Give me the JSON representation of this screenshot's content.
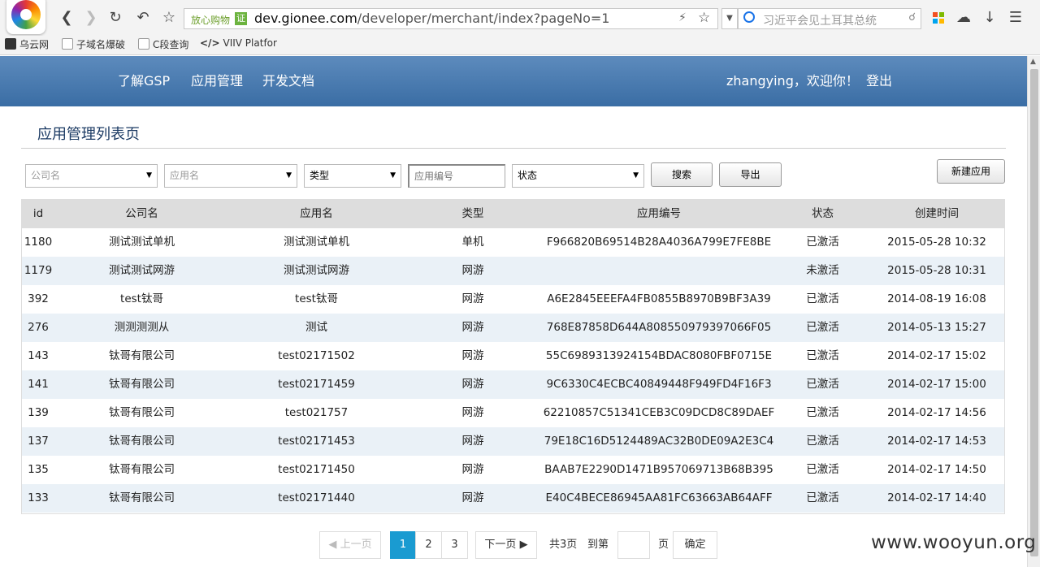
{
  "browser": {
    "secure_label": "放心购物",
    "cert_badge": "证",
    "url_host": "dev.gionee.com",
    "url_path": "/developer/merchant/index?pageNo=1",
    "search_placeholder": "习近平会见土耳其总统",
    "bookmarks": [
      "乌云网",
      "子域名爆破",
      "C段查询",
      "VIIV Platfor"
    ]
  },
  "header": {
    "nav": [
      "了解GSP",
      "应用管理",
      "开发文档"
    ],
    "welcome": "zhangying，欢迎你！",
    "logout": "登出"
  },
  "page_title": "应用管理列表页",
  "filters": {
    "company_placeholder": "公司名",
    "app_placeholder": "应用名",
    "type_value": "类型",
    "appno_placeholder": "应用编号",
    "status_value": "状态",
    "search_btn": "搜索",
    "export_btn": "导出",
    "new_btn": "新建应用"
  },
  "table": {
    "headers": [
      "id",
      "公司名",
      "应用名",
      "类型",
      "应用编号",
      "状态",
      "创建时间"
    ],
    "rows": [
      [
        "1180",
        "测试测试单机",
        "测试测试单机",
        "单机",
        "F966820B69514B28A4036A799E7FE8BE",
        "已激活",
        "2015-05-28 10:32"
      ],
      [
        "1179",
        "测试测试网游",
        "测试测试网游",
        "网游",
        "",
        "未激活",
        "2015-05-28 10:31"
      ],
      [
        "392",
        "test钛哥",
        "test钛哥",
        "网游",
        "A6E2845EEEFA4FB0855B8970B9BF3A39",
        "已激活",
        "2014-08-19 16:08"
      ],
      [
        "276",
        "测测测测从",
        "测试",
        "网游",
        "768E87858D644A808550979397066F05",
        "已激活",
        "2014-05-13 15:27"
      ],
      [
        "143",
        "钛哥有限公司",
        "test02171502",
        "网游",
        "55C6989313924154BDAC8080FBF0715E",
        "已激活",
        "2014-02-17 15:02"
      ],
      [
        "141",
        "钛哥有限公司",
        "test02171459",
        "网游",
        "9C6330C4ECBC40849448F949FD4F16F3",
        "已激活",
        "2014-02-17 15:00"
      ],
      [
        "139",
        "钛哥有限公司",
        "test021757",
        "网游",
        "62210857C51341CEB3C09DCD8C89DAEF",
        "已激活",
        "2014-02-17 14:56"
      ],
      [
        "137",
        "钛哥有限公司",
        "test02171453",
        "网游",
        "79E18C16D5124489AC32B0DE09A2E3C4",
        "已激活",
        "2014-02-17 14:53"
      ],
      [
        "135",
        "钛哥有限公司",
        "test02171450",
        "网游",
        "BAAB7E2290D1471B957069713B68B395",
        "已激活",
        "2014-02-17 14:50"
      ],
      [
        "133",
        "钛哥有限公司",
        "test02171440",
        "网游",
        "E40C4BECE86945AA81FC63663AB64AFF",
        "已激活",
        "2014-02-17 14:40"
      ]
    ]
  },
  "pager": {
    "prev": "上一页",
    "pages": [
      "1",
      "2",
      "3"
    ],
    "current": "1",
    "next": "下一页",
    "total": "共3页",
    "goto": "到第",
    "unit": "页",
    "confirm": "确定"
  },
  "watermark": "www.wooyun.org",
  "colors": {
    "header": "#4a7db3",
    "page_active": "#1a9bd1",
    "row_alt": "#eaf1f7"
  }
}
